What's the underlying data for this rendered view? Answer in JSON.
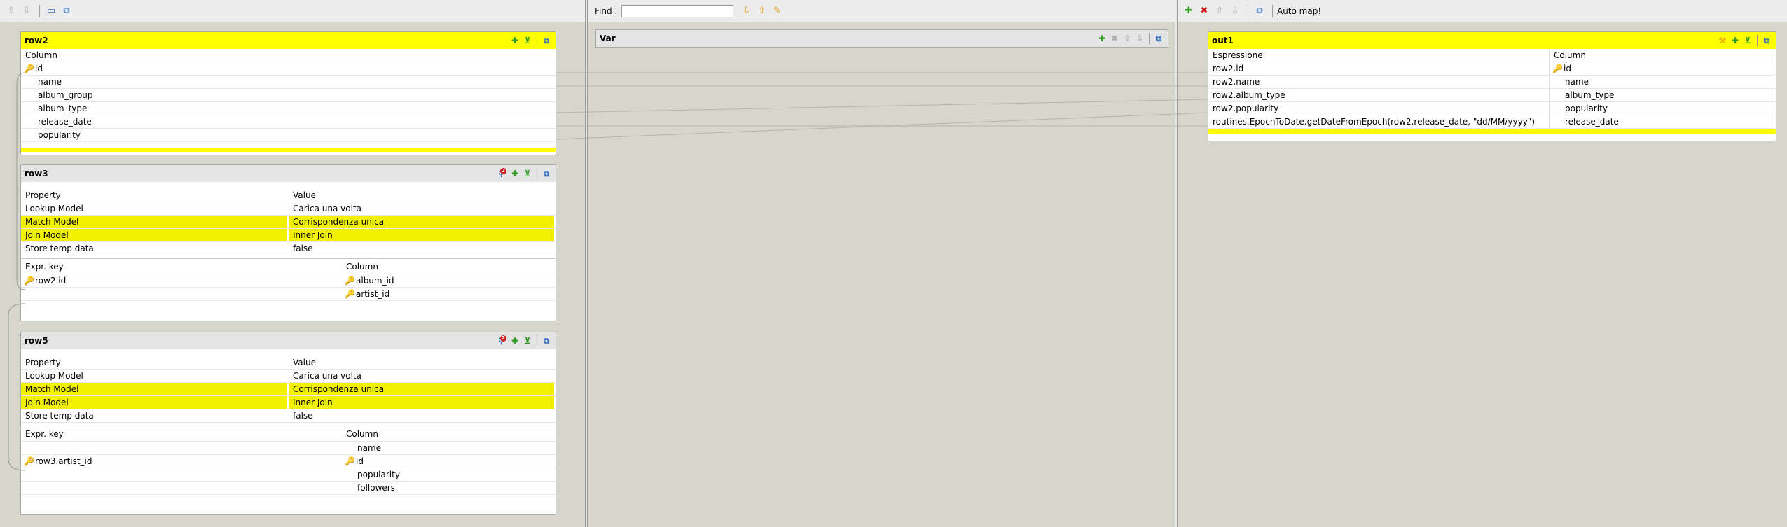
{
  "left_toolbar": {
    "icons": [
      "arrow-up-icon",
      "arrow-down-icon",
      "minimize-icon",
      "tooltip-icon"
    ]
  },
  "var_toolbar": {
    "find_label": "Find :",
    "find_value": ""
  },
  "out_toolbar": {
    "auto_map_label": "Auto map!"
  },
  "row2": {
    "title": "row2",
    "column_header": "Column",
    "columns": [
      "id",
      "name",
      "album_group",
      "album_type",
      "release_date",
      "popularity"
    ]
  },
  "row3": {
    "title": "row3",
    "property_header": "Property",
    "value_header": "Value",
    "properties": [
      {
        "name": "Lookup Model",
        "value": "Carica una volta"
      },
      {
        "name": "Match Model",
        "value": "Corrispondenza unica"
      },
      {
        "name": "Join Model",
        "value": "Inner Join"
      },
      {
        "name": "Store temp data",
        "value": "false"
      }
    ],
    "expr_header": "Expr. key",
    "column_header": "Column",
    "rows": [
      {
        "expr": "row2.id",
        "column": "album_id"
      },
      {
        "expr": "",
        "column": "artist_id"
      }
    ]
  },
  "row5": {
    "title": "row5",
    "property_header": "Property",
    "value_header": "Value",
    "properties": [
      {
        "name": "Lookup Model",
        "value": "Carica una volta"
      },
      {
        "name": "Match Model",
        "value": "Corrispondenza unica"
      },
      {
        "name": "Join Model",
        "value": "Inner Join"
      },
      {
        "name": "Store temp data",
        "value": "false"
      }
    ],
    "expr_header": "Expr. key",
    "column_header": "Column",
    "rows": [
      {
        "expr": "",
        "column": "name"
      },
      {
        "expr": "row3.artist_id",
        "column": "id"
      },
      {
        "expr": "",
        "column": "popularity"
      },
      {
        "expr": "",
        "column": "followers"
      }
    ]
  },
  "var": {
    "title": "Var"
  },
  "out1": {
    "title": "out1",
    "expr_header": "Espressione",
    "column_header": "Column",
    "rows": [
      {
        "expr": "row2.id",
        "column": "id"
      },
      {
        "expr": "row2.name",
        "column": "name"
      },
      {
        "expr": "row2.album_type",
        "column": "album_type"
      },
      {
        "expr": "row2.popularity",
        "column": "popularity"
      },
      {
        "expr": "routines.EpochToDate.getDateFromEpoch(row2.release_date, \"dd/MM/yyyy\")",
        "column": "release_date"
      }
    ]
  }
}
